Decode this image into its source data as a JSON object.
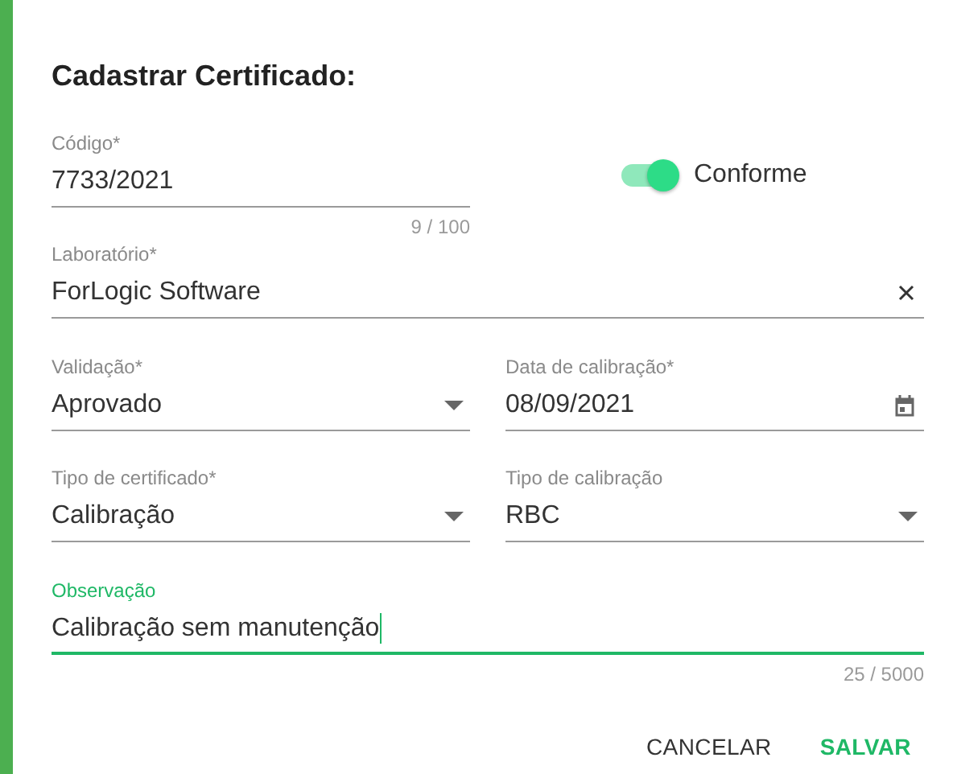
{
  "title": "Cadastrar Certificado:",
  "rows": [
    [
      {
        "kind": "text",
        "label": "Código*",
        "value": "7733/2021",
        "counter": "9 / 100",
        "focused": false
      },
      {
        "kind": "toggle",
        "label": "Conforme",
        "on": true
      }
    ],
    [
      {
        "kind": "clearable",
        "label": "Laboratório*",
        "value": "ForLogic Software",
        "focused": false
      }
    ],
    [
      {
        "kind": "select",
        "label": "Validação*",
        "value": "Aprovado",
        "focused": false
      },
      {
        "kind": "date",
        "label": "Data de calibração*",
        "value": "08/09/2021",
        "focused": false
      }
    ],
    [
      {
        "kind": "select",
        "label": "Tipo de certificado*",
        "value": "Calibração",
        "focused": false
      },
      {
        "kind": "select",
        "label": "Tipo de calibração",
        "value": "RBC",
        "focused": false
      }
    ],
    [
      {
        "kind": "text",
        "label": "Observação",
        "value": "Calibração sem manutenção",
        "counter": "25 / 5000",
        "focused": true
      }
    ]
  ],
  "buttons": [
    {
      "kind": "plain",
      "label": "CANCELAR"
    },
    {
      "kind": "primary",
      "label": "SALVAR"
    }
  ]
}
